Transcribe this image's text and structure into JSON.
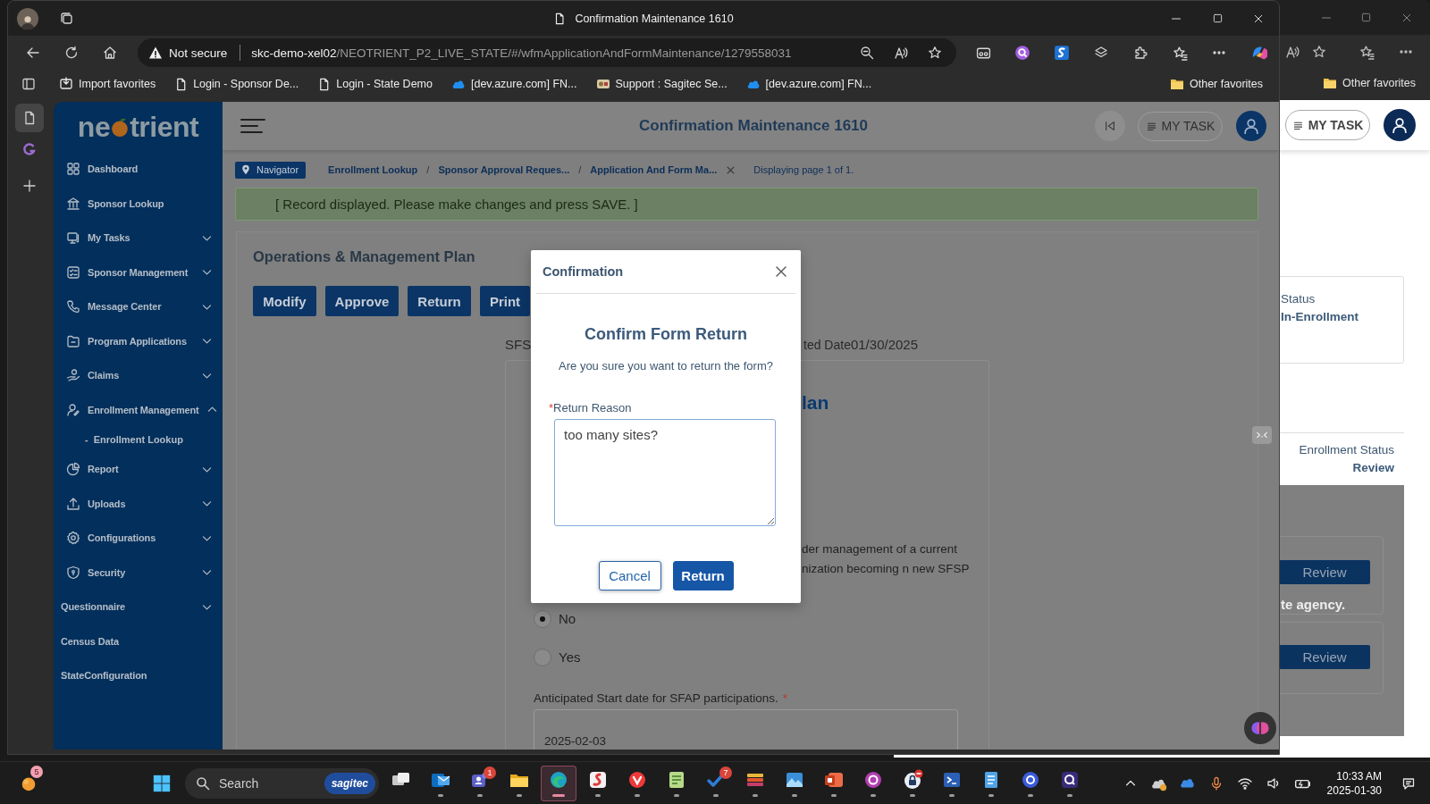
{
  "front_window": {
    "title": "Confirmation Maintenance 1610",
    "address": {
      "security": "Not secure",
      "host": "skc-demo-xel02",
      "path": "/NEOTRIENT_P2_LIVE_STATE/#/wfmApplicationAndFormMaintenance/1279558031"
    },
    "favorites": [
      {
        "label": "Import favorites",
        "kind": "import"
      },
      {
        "label": "Login - Sponsor De...",
        "kind": "page"
      },
      {
        "label": "Login - State Demo",
        "kind": "page"
      },
      {
        "label": "[dev.azure.com] FN...",
        "kind": "azure"
      },
      {
        "label": "Support : Sagitec Se...",
        "kind": "site"
      },
      {
        "label": "[dev.azure.com] FN...",
        "kind": "azure"
      }
    ],
    "other_favorites": "Other favorites"
  },
  "app": {
    "logo": {
      "start": "ne",
      "end": "trient"
    },
    "nav": [
      {
        "label": "Dashboard",
        "kind": "item"
      },
      {
        "label": "Sponsor Lookup",
        "kind": "item"
      },
      {
        "label": "My Tasks",
        "kind": "item",
        "expanded": false
      },
      {
        "label": "Sponsor Management",
        "kind": "item",
        "expanded": false
      },
      {
        "label": "Message Center",
        "kind": "item",
        "expanded": false
      },
      {
        "label": "Program Applications",
        "kind": "item",
        "expanded": false
      },
      {
        "label": "Claims",
        "kind": "item",
        "expanded": false
      },
      {
        "label": "Enrollment Management",
        "kind": "item",
        "expanded": true,
        "children": [
          {
            "marker": "-",
            "label": "Enrollment Lookup"
          }
        ]
      },
      {
        "label": "Report",
        "kind": "item",
        "expanded": false
      },
      {
        "label": "Uploads",
        "kind": "item",
        "expanded": false
      },
      {
        "label": "Configurations",
        "kind": "item",
        "expanded": false
      },
      {
        "label": "Security",
        "kind": "item",
        "expanded": false
      },
      {
        "label": "Questionnaire",
        "kind": "bare",
        "expanded": false
      },
      {
        "label": "Census Data",
        "kind": "bare"
      },
      {
        "label": "StateConfiguration",
        "kind": "bare"
      }
    ],
    "header": {
      "title": "Confirmation Maintenance 1610",
      "my_task": "MY TASK"
    },
    "breadcrumb": {
      "navigator": "Navigator",
      "items": [
        {
          "label": "Enrollment Lookup",
          "kind": "link"
        },
        {
          "label": "/",
          "kind": "separator"
        },
        {
          "label": "Sponsor Approval Reques...",
          "kind": "link"
        },
        {
          "label": "/",
          "kind": "separator"
        },
        {
          "label": "Application And Form Ma...",
          "kind": "link"
        }
      ],
      "paging": "Displaying page 1 of 1."
    },
    "message": "[ Record displayed. Please make changes and press SAVE. ]",
    "section": {
      "title": "Operations & Management Plan",
      "actions": [
        "Modify",
        "Approve",
        "Return",
        "Print"
      ],
      "info_left": "SFS",
      "date_label": "ted Date",
      "date_value": "01/30/2025"
    },
    "form": {
      "heading": "lan",
      "lines": [
        "der management of a current",
        "nization becoming n new SFSP"
      ],
      "options": [
        {
          "label": "No",
          "selected": true
        },
        {
          "label": "Yes",
          "selected": false
        }
      ],
      "start_label": "Anticipated Start date for SFAP participations.",
      "start_required": "*",
      "start_value": "2025-02-03"
    }
  },
  "dialog": {
    "title": "Confirmation",
    "heading": "Confirm Form Return",
    "question": "Are you sure you want to return the form?",
    "field": {
      "required": "*",
      "label": "Return Reason",
      "value": "too many sites?"
    },
    "buttons": [
      {
        "label": "Cancel",
        "kind": "secondary"
      },
      {
        "label": "Return",
        "kind": "primary"
      }
    ]
  },
  "back_window": {
    "other_favorites": "Other favorites",
    "my_task": "MY TASK",
    "status_label": "Status",
    "status_value": "In-Enrollment",
    "enrollment_label": "Enrollment Status",
    "enrollment_value": "Review",
    "review_buttons": [
      "Review",
      "Review"
    ],
    "note": "te agency."
  },
  "taskbar": {
    "weather_badge": "5",
    "search": "Search",
    "search_logo": "sagitec",
    "apps": [
      {
        "open": false,
        "selected": false
      },
      {
        "open": true,
        "selected": false
      },
      {
        "open": true,
        "selected": false,
        "badge": "1"
      },
      {
        "open": true,
        "selected": false
      },
      {
        "open": true,
        "selected": true
      },
      {
        "open": true,
        "selected": false
      },
      {
        "open": true,
        "selected": false
      },
      {
        "open": true,
        "selected": false
      },
      {
        "open": true,
        "selected": false,
        "badge": "7"
      },
      {
        "open": true,
        "selected": false
      },
      {
        "open": true,
        "selected": false
      },
      {
        "open": true,
        "selected": false
      },
      {
        "open": true,
        "selected": false
      },
      {
        "open": true,
        "selected": false
      },
      {
        "open": true,
        "selected": false
      },
      {
        "open": true,
        "selected": false
      },
      {
        "open": true,
        "selected": false
      },
      {
        "open": true,
        "selected": false
      }
    ],
    "time": "10:33 AM",
    "date": "2025-01-30"
  }
}
